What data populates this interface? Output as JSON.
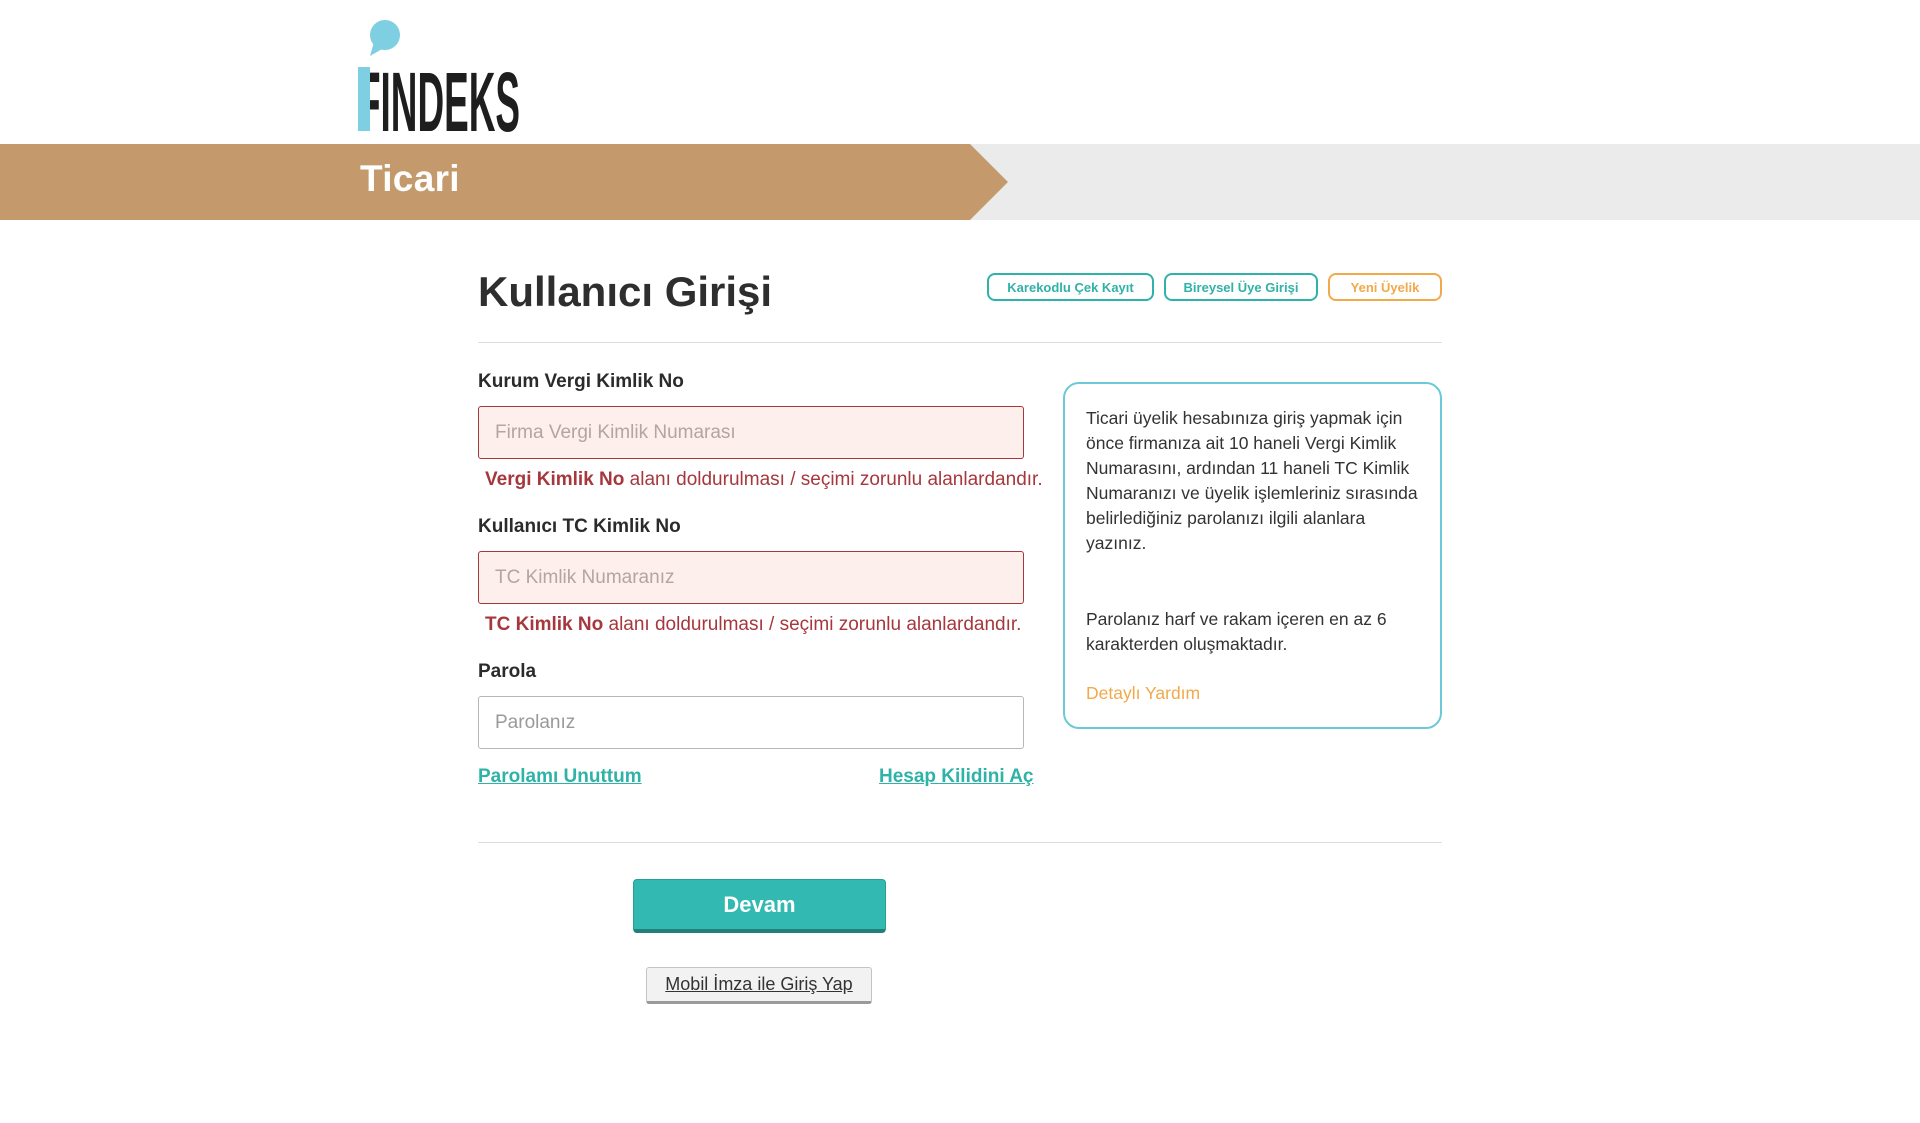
{
  "brand": {
    "logo_text": "FINDEKS",
    "accent": "#2fb2a8",
    "banner_color": "#c49a6c",
    "error_color": "#a6373d",
    "warning_color": "#f2a94a"
  },
  "banner": {
    "title": "Ticari"
  },
  "page": {
    "title": "Kullanıcı Girişi",
    "top_buttons": {
      "karekod": "Karekodlu Çek Kayıt",
      "bireysel": "Bireysel Üye Girişi",
      "yeni": "Yeni Üyelik"
    }
  },
  "form": {
    "vkn": {
      "label": "Kurum Vergi Kimlik No",
      "placeholder": "Firma Vergi Kimlik Numarası",
      "error_field": "Vergi Kimlik No",
      "error_text": " alanı doldurulması / seçimi zorunlu alanlardandır."
    },
    "tckn": {
      "label": "Kullanıcı TC Kimlik No",
      "placeholder": "TC Kimlik Numaranız",
      "error_field": "TC Kimlik No",
      "error_text": " alanı doldurulması / seçimi zorunlu alanlardandır."
    },
    "password": {
      "label": "Parola",
      "placeholder": "Parolanız"
    },
    "forgot_link": "Parolamı Unuttum",
    "unlock_link": "Hesap Kilidini Aç"
  },
  "info": {
    "paragraph1": "Ticari üyelik hesabınıza giriş yapmak için önce firmanıza ait 10 haneli Vergi Kimlik Numarasını, ardından 11 haneli TC Kimlik Numaranızı ve üyelik işlemleriniz sırasında belirlediğiniz parolanızı ilgili alanlara yazınız.",
    "paragraph2": "Parolanız harf ve rakam içeren en az 6 karakterden oluşmaktadır.",
    "help_link": "Detaylı Yardım"
  },
  "actions": {
    "continue": "Devam",
    "mobile_signature": "Mobil İmza ile Giriş Yap"
  }
}
